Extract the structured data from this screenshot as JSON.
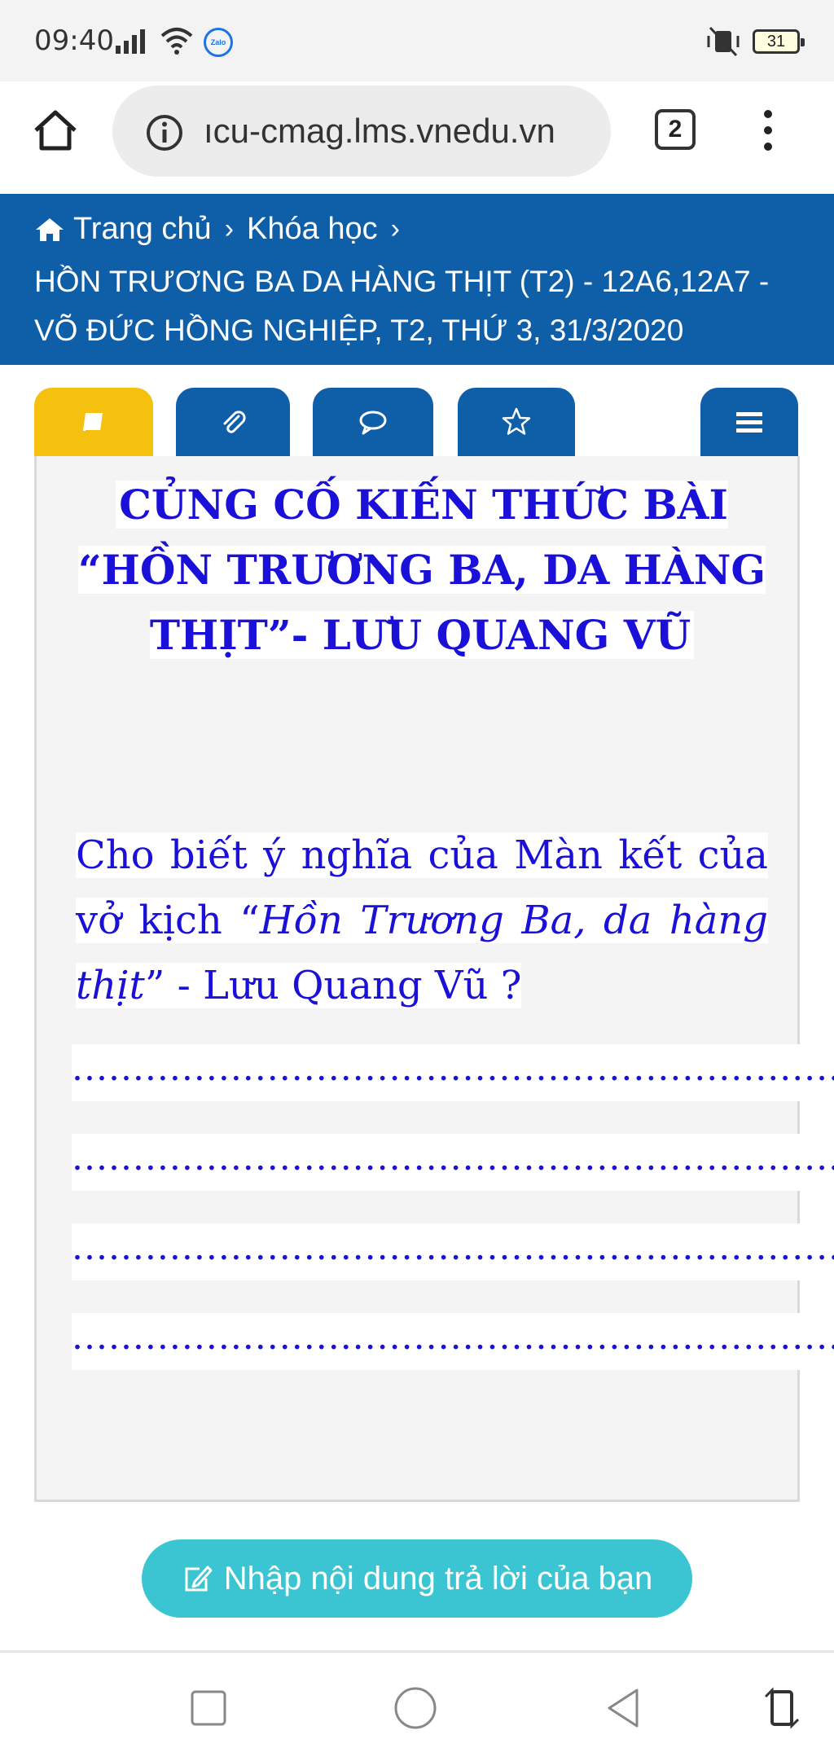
{
  "status_bar": {
    "time": "09:40",
    "battery": "31",
    "zalo_label": "Zalo"
  },
  "browser": {
    "url": "ıcu-cmag.lms.vnedu.vn",
    "tab_count": "2"
  },
  "header": {
    "breadcrumb": [
      "Trang chủ",
      "Khóa học"
    ],
    "course_title": "HỒN TRƯƠNG BA DA HÀNG THỊT (T2) - 12A6,12A7 - VÕ ĐỨC HỒNG NGHIỆP, T2, THỨ 3, 31/3/2020"
  },
  "tabs": [
    {
      "icon": "book-icon",
      "active": true
    },
    {
      "icon": "paperclip-icon",
      "active": false
    },
    {
      "icon": "comment-icon",
      "active": false
    },
    {
      "icon": "star-icon",
      "active": false
    },
    {
      "icon": "hamburger-menu-icon",
      "active": false
    }
  ],
  "content": {
    "title": "CỦNG CỐ KIẾN THỨC BÀI “HỒN TRƯƠNG BA, DA HÀNG THỊT”- LƯU QUANG VŨ",
    "question_part1": "Cho biết ý nghĩa của Màn kết của vở kịch “",
    "question_italic": "Hồn Trương Ba, da hàng thịt",
    "question_part2": "” -  Lưu Quang Vũ  ?",
    "answer_lines": [
      "...............................................................................................",
      "...............................................................................................",
      "...............................................................................................",
      "..............................................................................................."
    ]
  },
  "answer_button": {
    "label": "Nhập nội dung trả lời của bạn"
  },
  "colors": {
    "header_blue": "#0e5ea8",
    "active_tab": "#f5c10e",
    "question_text": "#1a10d8",
    "answer_button": "#3bc5d3"
  }
}
